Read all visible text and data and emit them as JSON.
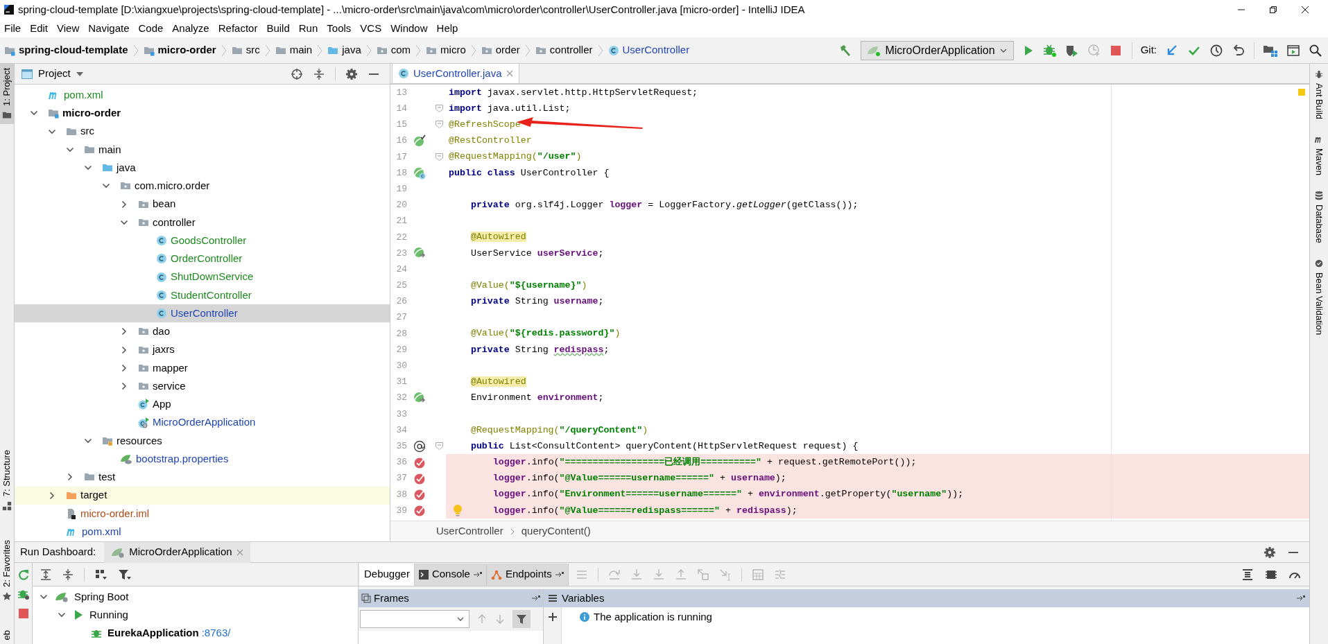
{
  "window": {
    "title": "spring-cloud-template [D:\\xiangxue\\projects\\spring-cloud-template] - ...\\micro-order\\src\\main\\java\\com\\micro\\order\\controller\\UserController.java [micro-order] - IntelliJ IDEA"
  },
  "menu": [
    "File",
    "Edit",
    "View",
    "Navigate",
    "Code",
    "Analyze",
    "Refactor",
    "Build",
    "Run",
    "Tools",
    "VCS",
    "Window",
    "Help"
  ],
  "breadcrumbs": [
    {
      "label": "spring-cloud-template",
      "kind": "module",
      "bold": true
    },
    {
      "label": "micro-order",
      "kind": "module",
      "bold": true
    },
    {
      "label": "src",
      "kind": "folder",
      "bold": false
    },
    {
      "label": "main",
      "kind": "folder",
      "bold": false
    },
    {
      "label": "java",
      "kind": "source",
      "bold": false
    },
    {
      "label": "com",
      "kind": "package",
      "bold": false
    },
    {
      "label": "micro",
      "kind": "package",
      "bold": false
    },
    {
      "label": "order",
      "kind": "package",
      "bold": false
    },
    {
      "label": "controller",
      "kind": "package",
      "bold": false
    },
    {
      "label": "UserController",
      "kind": "class",
      "bold": false
    }
  ],
  "run_config": {
    "label": "MicroOrderApplication"
  },
  "git_label": "Git:",
  "left_tool_tabs_top": [
    {
      "label": "1: Project",
      "selected": true
    }
  ],
  "left_tool_tabs_bottom": [
    {
      "label": "7: Structure",
      "selected": false
    },
    {
      "label": "2: Favorites",
      "selected": false
    },
    {
      "label": "eb",
      "selected": false
    }
  ],
  "right_tool_tabs": [
    {
      "label": "Ant Build",
      "kind": "ant"
    },
    {
      "label": "Maven",
      "kind": "maven"
    },
    {
      "label": "Database",
      "kind": "database"
    },
    {
      "label": "Bean Validation",
      "kind": "bean"
    }
  ],
  "project_panel": {
    "title": "Project",
    "tree": [
      {
        "label": "pom.xml",
        "kind": "maven",
        "color": "#1c8a1c",
        "selected": false
      },
      {
        "label": "micro-order",
        "kind": "module",
        "color": "#000000",
        "bold": true,
        "expanded": true,
        "selected": false,
        "children": [
          {
            "label": "src",
            "kind": "folder",
            "color": "#000000",
            "expanded": true,
            "selected": false,
            "children": [
              {
                "label": "main",
                "kind": "folder",
                "color": "#000000",
                "expanded": true,
                "selected": false,
                "children": [
                  {
                    "label": "java",
                    "kind": "source",
                    "color": "#000000",
                    "expanded": true,
                    "selected": false,
                    "children": [
                      {
                        "label": "com.micro.order",
                        "kind": "package",
                        "color": "#000000",
                        "expanded": true,
                        "selected": false,
                        "children": [
                          {
                            "label": "bean",
                            "kind": "package",
                            "color": "#000000",
                            "expanded": false,
                            "selected": false
                          },
                          {
                            "label": "controller",
                            "kind": "package",
                            "color": "#000000",
                            "expanded": true,
                            "selected": false,
                            "children": [
                              {
                                "label": "GoodsController",
                                "kind": "class",
                                "color": "#1c8a1c",
                                "selected": false
                              },
                              {
                                "label": "OrderController",
                                "kind": "class",
                                "color": "#1c8a1c",
                                "selected": false
                              },
                              {
                                "label": "ShutDownService",
                                "kind": "class",
                                "color": "#1c8a1c",
                                "selected": false
                              },
                              {
                                "label": "StudentController",
                                "kind": "class",
                                "color": "#1c8a1c",
                                "selected": false
                              },
                              {
                                "label": "UserController",
                                "kind": "class",
                                "color": "#1f45b5",
                                "selected": true
                              }
                            ]
                          },
                          {
                            "label": "dao",
                            "kind": "package",
                            "color": "#000000",
                            "expanded": false,
                            "selected": false
                          },
                          {
                            "label": "jaxrs",
                            "kind": "package",
                            "color": "#000000",
                            "expanded": false,
                            "selected": false
                          },
                          {
                            "label": "mapper",
                            "kind": "package",
                            "color": "#000000",
                            "expanded": false,
                            "selected": false
                          },
                          {
                            "label": "service",
                            "kind": "package",
                            "color": "#000000",
                            "expanded": false,
                            "selected": false
                          },
                          {
                            "label": "App",
                            "kind": "app",
                            "color": "#000000",
                            "selected": false
                          },
                          {
                            "label": "MicroOrderApplication",
                            "kind": "springapp",
                            "color": "#1f45b5",
                            "selected": false
                          }
                        ]
                      }
                    ]
                  },
                  {
                    "label": "resources",
                    "kind": "resources",
                    "color": "#000000",
                    "expanded": true,
                    "selected": false,
                    "children": [
                      {
                        "label": "bootstrap.properties",
                        "kind": "properties",
                        "color": "#1f45b5",
                        "selected": false
                      }
                    ]
                  }
                ]
              },
              {
                "label": "test",
                "kind": "folder",
                "color": "#000000",
                "expanded": false,
                "selected": false
              }
            ]
          },
          {
            "label": "target",
            "kind": "excluded",
            "color": "#000000",
            "expanded": false,
            "selected": false
          },
          {
            "label": "micro-order.iml",
            "kind": "iml",
            "color": "#b04a17",
            "selected": false
          },
          {
            "label": "pom.xml",
            "kind": "maven",
            "color": "#1f45b5",
            "selected": false
          }
        ]
      }
    ]
  },
  "editor": {
    "tab": {
      "label": "UserController.java",
      "selected": true
    },
    "lines": [
      {
        "number": "13",
        "code": [
          {
            "kind": "keyword",
            "text": "import"
          },
          {
            "kind": "plain",
            "text": " javax.servlet.http.HttpServletRequest;"
          }
        ],
        "fold": false,
        "breakpoint": false,
        "bulb": false
      },
      {
        "number": "14",
        "code": [
          {
            "kind": "keyword",
            "text": "import"
          },
          {
            "kind": "plain",
            "text": " java.util.List;"
          }
        ],
        "fold": true,
        "breakpoint": false,
        "bulb": false
      },
      {
        "number": "15",
        "code": [
          {
            "kind": "annotation",
            "text": "@RefreshScope"
          }
        ],
        "fold": true,
        "breakpoint": false,
        "bulb": false
      },
      {
        "number": "16",
        "kind": "bean",
        "code": [
          {
            "kind": "annotation",
            "text": "@RestController"
          }
        ],
        "fold": false,
        "breakpoint": false,
        "bulb": false
      },
      {
        "number": "17",
        "code": [
          {
            "kind": "annotation",
            "text": "@RequestMapping("
          },
          {
            "kind": "string",
            "text": "\"/user\""
          },
          {
            "kind": "annotation",
            "text": ")"
          }
        ],
        "fold": true,
        "breakpoint": false,
        "bulb": false
      },
      {
        "number": "18",
        "kind": "beanclass",
        "code": [
          {
            "kind": "keyword",
            "text": "public class"
          },
          {
            "kind": "plain",
            "text": " UserController {"
          }
        ],
        "fold": false,
        "breakpoint": false,
        "bulb": false
      },
      {
        "number": "19",
        "fold": false,
        "breakpoint": false,
        "bulb": false
      },
      {
        "number": "20",
        "code": [
          {
            "kind": "keyword",
            "text": "    private"
          },
          {
            "kind": "plain",
            "text": " org.slf4j.Logger "
          },
          {
            "kind": "field",
            "text": "logger"
          },
          {
            "kind": "plain",
            "text": " = LoggerFactory."
          },
          {
            "kind": "static",
            "text": "getLogger"
          },
          {
            "kind": "plain",
            "text": "(getClass());"
          }
        ],
        "fold": false,
        "breakpoint": false,
        "bulb": false
      },
      {
        "number": "21",
        "fold": false,
        "breakpoint": false,
        "bulb": false
      },
      {
        "number": "22",
        "code": [
          {
            "kind": "marked",
            "text": "    @Autowired"
          }
        ],
        "fold": false,
        "breakpoint": false,
        "bulb": false
      },
      {
        "number": "23",
        "kind": "autowired",
        "code": [
          {
            "kind": "plain",
            "text": "    UserService "
          },
          {
            "kind": "field",
            "text": "userService"
          },
          {
            "kind": "plain",
            "text": ";"
          }
        ],
        "fold": false,
        "breakpoint": false,
        "bulb": false
      },
      {
        "number": "24",
        "fold": false,
        "breakpoint": false,
        "bulb": false
      },
      {
        "number": "25",
        "code": [
          {
            "kind": "annotation",
            "text": "    @Value("
          },
          {
            "kind": "string",
            "text": "\"${username}\""
          },
          {
            "kind": "annotation",
            "text": ")"
          }
        ],
        "fold": false,
        "breakpoint": false,
        "bulb": false
      },
      {
        "number": "26",
        "code": [
          {
            "kind": "keyword",
            "text": "    private"
          },
          {
            "kind": "plain",
            "text": " String "
          },
          {
            "kind": "field",
            "text": "username"
          },
          {
            "kind": "plain",
            "text": ";"
          }
        ],
        "fold": false,
        "breakpoint": false,
        "bulb": false
      },
      {
        "number": "27",
        "fold": false,
        "breakpoint": false,
        "bulb": false
      },
      {
        "number": "28",
        "code": [
          {
            "kind": "annotation",
            "text": "    @Value("
          },
          {
            "kind": "string",
            "text": "\"${redis.password}\""
          },
          {
            "kind": "annotation",
            "text": ")"
          }
        ],
        "fold": false,
        "breakpoint": false,
        "bulb": false
      },
      {
        "number": "29",
        "code": [
          {
            "kind": "keyword",
            "text": "    private"
          },
          {
            "kind": "plain",
            "text": " String "
          },
          {
            "kind": "typo",
            "text": "redispass"
          },
          {
            "kind": "plain",
            "text": ";"
          }
        ],
        "fold": false,
        "breakpoint": false,
        "bulb": false
      },
      {
        "number": "30",
        "fold": false,
        "breakpoint": false,
        "bulb": false
      },
      {
        "number": "31",
        "code": [
          {
            "kind": "marked",
            "text": "    @Autowired"
          }
        ],
        "fold": false,
        "breakpoint": false,
        "bulb": false
      },
      {
        "number": "32",
        "kind": "autowired",
        "code": [
          {
            "kind": "plain",
            "text": "    Environment "
          },
          {
            "kind": "field",
            "text": "environment"
          },
          {
            "kind": "plain",
            "text": ";"
          }
        ],
        "fold": false,
        "breakpoint": false,
        "bulb": false
      },
      {
        "number": "33",
        "fold": false,
        "breakpoint": false,
        "bulb": false
      },
      {
        "number": "34",
        "code": [
          {
            "kind": "annotation",
            "text": "    @RequestMapping("
          },
          {
            "kind": "string",
            "text": "\"/queryContent\""
          },
          {
            "kind": "annotation",
            "text": ")"
          }
        ],
        "fold": false,
        "breakpoint": false,
        "bulb": false
      },
      {
        "number": "35",
        "kind": "at",
        "code": [
          {
            "kind": "keyword",
            "text": "    public"
          },
          {
            "kind": "plain",
            "text": " List<ConsultContent> queryContent(HttpServletRequest request) {"
          }
        ],
        "fold": true,
        "breakpoint": false,
        "bulb": false
      },
      {
        "number": "36",
        "code": [
          {
            "kind": "field",
            "text": "        logger"
          },
          {
            "kind": "plain",
            "text": ".info("
          },
          {
            "kind": "string",
            "text": "\"==================已经调用==========\""
          },
          {
            "kind": "plain",
            "text": " + request.getRemotePort());"
          }
        ],
        "fold": false,
        "breakpoint": true,
        "bulb": false
      },
      {
        "number": "37",
        "code": [
          {
            "kind": "field",
            "text": "        logger"
          },
          {
            "kind": "plain",
            "text": ".info("
          },
          {
            "kind": "string",
            "text": "\"@Value======username======\""
          },
          {
            "kind": "plain",
            "text": " + "
          },
          {
            "kind": "field",
            "text": "username"
          },
          {
            "kind": "plain",
            "text": ");"
          }
        ],
        "fold": false,
        "breakpoint": true,
        "bulb": false
      },
      {
        "number": "38",
        "code": [
          {
            "kind": "field",
            "text": "        logger"
          },
          {
            "kind": "plain",
            "text": ".info("
          },
          {
            "kind": "string",
            "text": "\"Environment======username======\""
          },
          {
            "kind": "plain",
            "text": " + "
          },
          {
            "kind": "field",
            "text": "environment"
          },
          {
            "kind": "plain",
            "text": ".getProperty("
          },
          {
            "kind": "string",
            "text": "\"username\""
          },
          {
            "kind": "plain",
            "text": "));"
          }
        ],
        "fold": false,
        "breakpoint": true,
        "bulb": false
      },
      {
        "number": "39",
        "code": [
          {
            "kind": "field",
            "text": "        logger"
          },
          {
            "kind": "plain",
            "text": ".info("
          },
          {
            "kind": "string",
            "text": "\"@Value======redispass======\""
          },
          {
            "kind": "plain",
            "text": " + "
          },
          {
            "kind": "field",
            "text": "redispass"
          },
          {
            "kind": "plain",
            "text": ");"
          }
        ],
        "fold": false,
        "breakpoint": true,
        "bulb": true
      }
    ],
    "breadcrumbs": [
      "UserController",
      "queryContent()"
    ]
  },
  "run_dashboard": {
    "title": "Run Dashboard:",
    "tab": "MicroOrderApplication",
    "tree": [
      {
        "label": "Spring Boot",
        "kind": "spring",
        "expanded": true,
        "children": [
          {
            "label": "Running",
            "kind": "running",
            "expanded": true,
            "children": [
              {
                "label": "EurekaApplication",
                "kind": "bug",
                "port": ":8763/"
              }
            ]
          }
        ]
      }
    ],
    "debugger_tabs": [
      {
        "label": "Debugger",
        "kind": "plain",
        "selected": true
      },
      {
        "label": "Console",
        "kind": "console",
        "selected": false
      },
      {
        "label": "Endpoints",
        "kind": "endpoints",
        "selected": false
      }
    ],
    "frames_title": "Frames",
    "variables_title": "Variables",
    "message": "The application is running"
  }
}
